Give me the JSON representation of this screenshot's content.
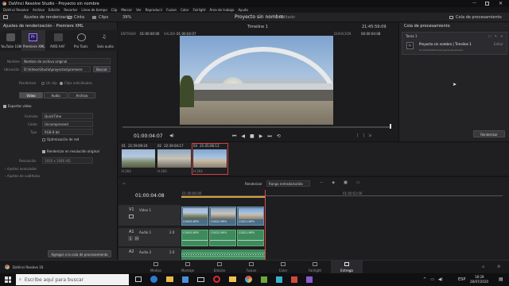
{
  "window": {
    "title": "DaVinci Resolve Studio - Proyecto sin nombre"
  },
  "menubar": [
    "DaVinci Resolve",
    "Archivo",
    "Edición",
    "Recortar",
    "Línea de tiempo",
    "Clip",
    "Marcar",
    "Ver",
    "Reproducir",
    "Fusion",
    "Color",
    "Fairlight",
    "Área de trabajo",
    "Ayuda"
  ],
  "toolbar": {
    "render_settings": "Ajustes de renderización",
    "zoom": "39%",
    "project_name": "Proyecto sin nombre",
    "project_status": "Editado",
    "timeline_name": "Timeline 1",
    "timecode": "21:45:59:09",
    "render_queue": "Cola de procesamiento",
    "media_label": "Clips"
  },
  "left": {
    "title": "Ajustes de renderización - Premiere XML",
    "presets": [
      "YouTube 1080p",
      "Premiere XML",
      "AVID AAF",
      "Pro Tools",
      "Solo audio"
    ],
    "name_label": "Nombre",
    "name_value": "Nombre de archivo original",
    "location_label": "Ubicación",
    "location_value": "D:\\Videos\\Studio\\proyectos\\premiere",
    "browse": "Buscar",
    "render_label": "Renderizar",
    "render_opt1": "Un clip",
    "render_opt2": "Clips individuales",
    "tabs": [
      "Video",
      "Audio",
      "Archivo"
    ],
    "export_video": "Exportar video",
    "format_label": "Formato",
    "format_value": "QuickTime",
    "codec_label": "Códec",
    "codec_value": "Uncompressed",
    "type_label": "Tipo",
    "type_value": "RGB 8 bit",
    "optimize": "Optimización de red",
    "render_at_res": "Renderizar en resolución original",
    "resolution_label": "Resolución",
    "resolution_value": "1920 x 1080 HD",
    "adv_settings": "Ajustes avanzados",
    "subtitle_settings": "Ajustes de subtítulos",
    "add_queue": "Agregar a la cola de procesamiento"
  },
  "viewer": {
    "in_label": "ENTRADA",
    "in_tc": "01:00:00:00",
    "out_label": "SALIDA",
    "out_tc": "01:00:04:07",
    "duration_label": "DURACIÓN",
    "duration_tc": "00:00:04:08",
    "current_tc": "01:00:04:07"
  },
  "clips": [
    {
      "num": "01",
      "tc": "21:59:09:24",
      "codec": "H.264"
    },
    {
      "num": "02",
      "tc": "22:39:04:17",
      "codec": "H.264"
    },
    {
      "num": "03",
      "tc": "21:45:06:13",
      "codec": "H.264"
    }
  ],
  "queue": {
    "job_tag": "Tarea 1",
    "job_title": "Proyecto sin nombre | Timeline 1",
    "job_path": "D:\\Videos\\Studio\\proyectos\\premiere",
    "edit": "Editar",
    "render_button": "Renderizar"
  },
  "timeline": {
    "timecode": "01:00:04:08",
    "render_label": "Renderizar",
    "range_value": "Rango entrada/salida",
    "v1": "V1",
    "v1_name": "Video 1",
    "a1": "A1",
    "a1_name": "Audio 1",
    "a2": "A2",
    "a2_name": "Audio 2",
    "a_level": "2.0",
    "ruler": [
      "01:00:00:00",
      "01:00:02:00"
    ],
    "video_clips": [
      "C0003.MP4",
      "C0022.MP4",
      "C0021.MP4"
    ],
    "audio_clips": [
      "C0003.MP4",
      "C0022.MP4",
      "C0021.MP4"
    ]
  },
  "pages": [
    "Medios",
    "Montaje",
    "Edición",
    "Fusion",
    "Color",
    "Fairlight",
    "Entrega"
  ],
  "app_footer": "DaVinci Resolve 16",
  "taskbar": {
    "search_placeholder": "Escribe aquí para buscar",
    "lang": "ESP",
    "time": "18:28",
    "date": "28/07/2020"
  }
}
